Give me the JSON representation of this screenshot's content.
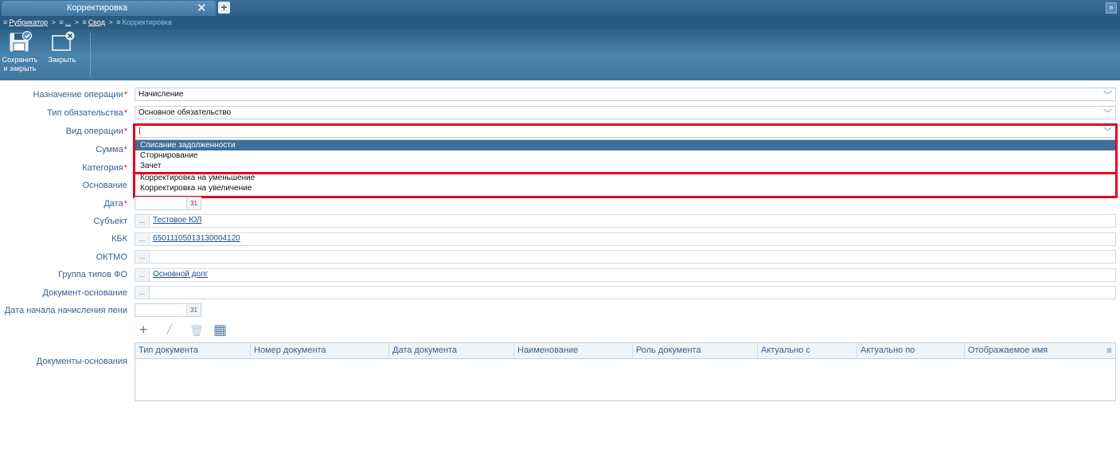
{
  "tab": {
    "title": "Корректировка",
    "close": "✕",
    "add": "+"
  },
  "window": {
    "collapse": "»"
  },
  "breadcrumb": {
    "rubricator": "Рубрикатор",
    "ellipsis": "...",
    "svod": "Свод",
    "current": "Корректировка",
    "sep": ">",
    "icon": "≡"
  },
  "toolbar": {
    "save_line1": "Сохранить",
    "save_line2": "и закрыть",
    "close": "Закрыть"
  },
  "form": {
    "operation_purpose": {
      "label": "Назначение операции",
      "value": "Начисление"
    },
    "obligation_type": {
      "label": "Тип обязательства",
      "value": "Основное обязательство"
    },
    "operation_kind": {
      "label": "Вид операции",
      "value": "|"
    },
    "sum": {
      "label": "Сумма"
    },
    "category": {
      "label": "Категория"
    },
    "basis": {
      "label": "Основание"
    },
    "date": {
      "label": "Дата",
      "cal": "31"
    },
    "subject": {
      "label": "Субъект",
      "value": "Тестовое ЮЛ"
    },
    "kbk": {
      "label": "КБК",
      "value": "65011105013130004120"
    },
    "oktmo": {
      "label": "ОКТМО",
      "value": ""
    },
    "fo_group": {
      "label": "Группа типов ФО",
      "value": "Основной долг"
    },
    "basis_doc": {
      "label": "Документ-основание",
      "value": ""
    },
    "penalty_start": {
      "label": "Дата начала начисления пени",
      "cal": "31"
    },
    "basis_docs": {
      "label": "Документы-основания"
    },
    "required_mark": "*",
    "dots": "...",
    "chevron": "﹀"
  },
  "dropdown": {
    "options": [
      "Списание задолженности",
      "Сторнирование",
      "Зачет",
      "Корректировка на уменьшение",
      "Корректировка на увеличение"
    ],
    "selected_index": 0
  },
  "docs_toolbar": {
    "add": "+",
    "edit": "/",
    "delete": "🗑",
    "table": "▦"
  },
  "grid": {
    "columns": [
      "Тип документа",
      "Номер документа",
      "Дата документа",
      "Наименование",
      "Роль документа",
      "Актуально с",
      "Актуально по",
      "Отображаемое имя"
    ],
    "menu": "≡"
  },
  "colors": {
    "accent": "#3d6f9a",
    "highlight": "#e8001c",
    "label": "#3a5f88"
  }
}
